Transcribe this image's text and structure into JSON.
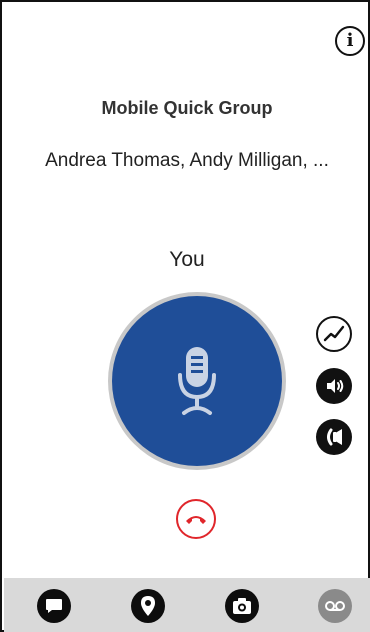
{
  "header": {
    "info_icon": "info-icon",
    "info_glyph": "i"
  },
  "call": {
    "group_name": "Mobile Quick Group",
    "members": "Andrea Thomas, Andy Milligan, ...",
    "current_speaker": "You",
    "ptt_icon": "microphone-icon",
    "ptt_color": "#1f4e98",
    "end_call_color": "#e0262b"
  },
  "side_controls": [
    {
      "icon": "network-activity-icon"
    },
    {
      "icon": "speaker-volume-icon"
    },
    {
      "icon": "call-mode-icon"
    }
  ],
  "bottom_tabs": [
    {
      "icon": "chat-icon"
    },
    {
      "icon": "location-icon"
    },
    {
      "icon": "camera-icon"
    },
    {
      "icon": "voicemail-icon"
    }
  ]
}
